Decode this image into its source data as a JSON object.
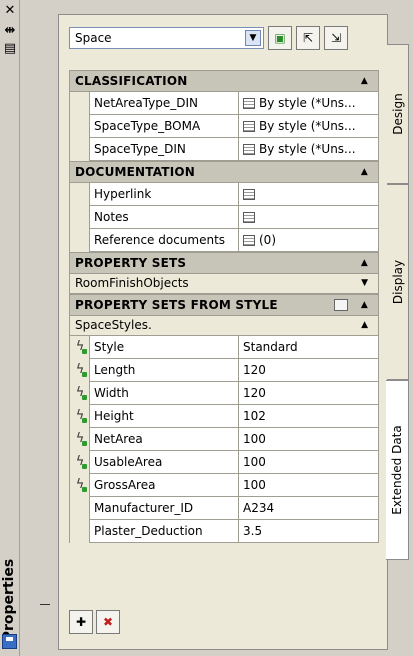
{
  "palette": {
    "window_bg": "#d4d0c8",
    "panel_bg": "#ece9d8",
    "header_bg": "#c7c4b8",
    "cell_bg": "#ffffff",
    "accent": "#3a6ec4"
  },
  "strip": {
    "close_icon": "close-icon",
    "autohide_icon": "autohide-icon",
    "menu_icon": "properties-menu-icon",
    "title": "Properties"
  },
  "toolbar": {
    "object_select": "Space",
    "buttons": [
      "select-objects-icon",
      "quick-select-icon",
      "toggle-pickadd-icon"
    ]
  },
  "sections": {
    "classification": {
      "title": "CLASSIFICATION",
      "rows": [
        {
          "name": "NetAreaType_DIN",
          "value": "By style (*Uns..."
        },
        {
          "name": "SpaceType_BOMA",
          "value": "By style (*Uns..."
        },
        {
          "name": "SpaceType_DIN",
          "value": "By style (*Uns..."
        }
      ]
    },
    "documentation": {
      "title": "DOCUMENTATION",
      "rows": [
        {
          "name": "Hyperlink",
          "value": ""
        },
        {
          "name": "Notes",
          "value": ""
        },
        {
          "name": "Reference documents",
          "value": "(0)"
        }
      ]
    },
    "property_sets": {
      "title": "PROPERTY SETS",
      "sub": "RoomFinishObjects"
    },
    "property_sets_from_style": {
      "title": "PROPERTY SETS FROM STYLE",
      "sub": "SpaceStyles.",
      "rows": [
        {
          "name": "Style",
          "value": "Standard",
          "auto": true
        },
        {
          "name": "Length",
          "value": "120",
          "auto": true
        },
        {
          "name": "Width",
          "value": "120",
          "auto": true
        },
        {
          "name": "Height",
          "value": "102",
          "auto": true
        },
        {
          "name": "NetArea",
          "value": "100",
          "auto": true
        },
        {
          "name": "UsableArea",
          "value": "100",
          "auto": true
        },
        {
          "name": "GrossArea",
          "value": "100",
          "auto": true
        },
        {
          "name": "Manufacturer_ID",
          "value": "A234",
          "auto": false
        },
        {
          "name": "Plaster_Deduction",
          "value": "3.5",
          "auto": false
        }
      ]
    }
  },
  "bottom_buttons": [
    "add-property-sets-icon",
    "remove-property-sets-icon"
  ],
  "tabs": [
    "Design",
    "Display",
    "Extended Data"
  ]
}
